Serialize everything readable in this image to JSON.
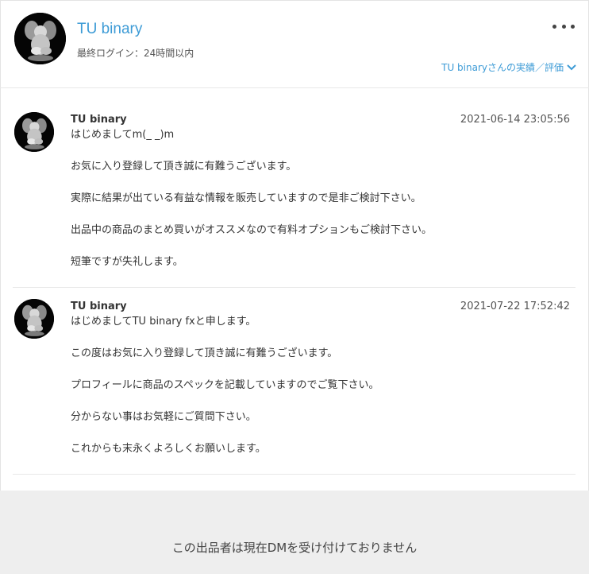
{
  "header": {
    "name": "TU binary",
    "last_login": "最終ログイン：24時間以内",
    "review_link": "TU binaryさんの実績／評価",
    "more_icon": "more-horizontal-icon"
  },
  "messages": [
    {
      "sender": "TU binary",
      "time": "2021-06-14 23:05:56",
      "lines": [
        "はじめましてm(_ _)m",
        "お気に入り登録して頂き誠に有難うございます。",
        "実際に結果が出ている有益な情報を販売していますので是非ご検討下さい。",
        "出品中の商品のまとめ買いがオススメなので有料オプションもご検討下さい。",
        "短筆ですが失礼します。"
      ]
    },
    {
      "sender": "TU binary",
      "time": "2021-07-22 17:52:42",
      "lines": [
        "はじめましてTU binary fxと申します。",
        "この度はお気に入り登録して頂き誠に有難うございます。",
        "プロフィールに商品のスペックを記載していますのでご覧下さい。",
        "分からない事はお気軽にご質問下さい。",
        "これからも末永くよろしくお願いします。"
      ]
    }
  ],
  "footer": {
    "notice": "この出品者は現在DMを受け付けておりません"
  },
  "colors": {
    "accent": "#3d9bd6",
    "footer_bg": "#eeeeee"
  }
}
